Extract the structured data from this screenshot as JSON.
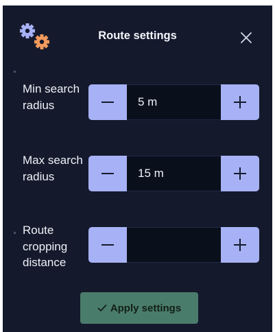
{
  "header": {
    "title": "Route settings",
    "settings_icon": "gears-icon",
    "close_icon": "close-icon"
  },
  "fields": [
    {
      "label": "Min search radius",
      "value": "5 m"
    },
    {
      "label": "Max search radius",
      "value": "15 m"
    },
    {
      "label": "Route cropping distance",
      "value": ""
    }
  ],
  "apply": {
    "label": "Apply settings",
    "icon": "check-icon"
  },
  "colors": {
    "panel_bg": "#141a2c",
    "stepper_button": "#a7b1f5",
    "input_bg": "#0a0f1c",
    "apply_bg": "#4a7c6b",
    "gear_blue": "#a7b1f5",
    "gear_orange": "#f29a5c"
  }
}
